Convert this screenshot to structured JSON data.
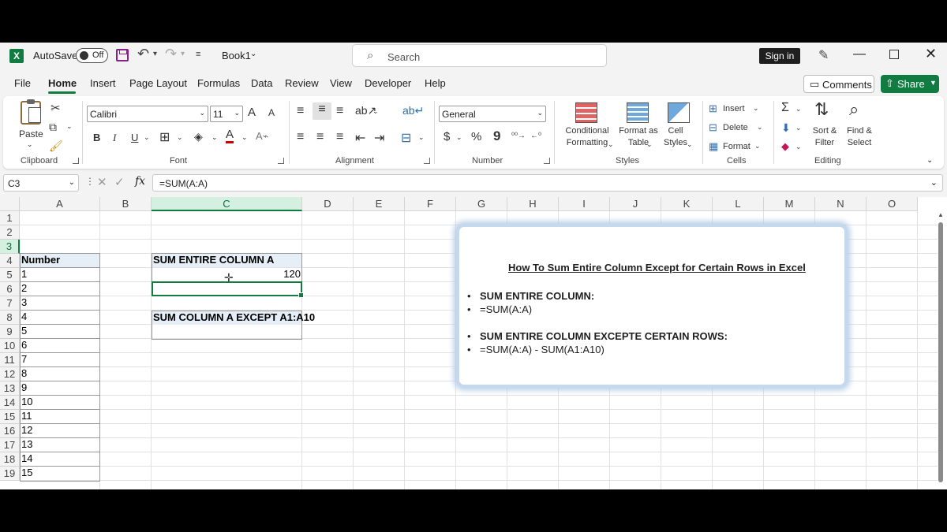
{
  "titlebar": {
    "autosave_label": "AutoSave",
    "autosave_state": "Off",
    "doc_title": "Book1",
    "search_placeholder": "Search",
    "signin_label": "Sign in"
  },
  "tabs": [
    "File",
    "Home",
    "Insert",
    "Page Layout",
    "Formulas",
    "Data",
    "Review",
    "View",
    "Developer",
    "Help"
  ],
  "active_tab": "Home",
  "tab_actions": {
    "comments": "Comments",
    "share": "Share"
  },
  "ribbon": {
    "clipboard": {
      "paste": "Paste",
      "label": "Clipboard"
    },
    "font": {
      "family": "Calibri",
      "size": "11",
      "label": "Font",
      "bold": "B",
      "italic": "I",
      "underline": "U",
      "grow": "A",
      "shrink": "A"
    },
    "alignment": {
      "label": "Alignment"
    },
    "number": {
      "format": "General",
      "currency": "$",
      "percent": "%",
      "comma": "9",
      "label": "Number"
    },
    "styles": {
      "conditional": [
        "Conditional",
        "Formatting"
      ],
      "format_table": [
        "Format as",
        "Table"
      ],
      "cell_styles": [
        "Cell",
        "Styles"
      ],
      "label": "Styles"
    },
    "cells": {
      "insert": "Insert",
      "delete": "Delete",
      "format": "Format",
      "label": "Cells"
    },
    "editing": {
      "sort": [
        "Sort &",
        "Filter"
      ],
      "find": [
        "Find &",
        "Select"
      ],
      "label": "Editing"
    }
  },
  "formula_bar": {
    "name_box": "C3",
    "formula": "=SUM(A:A)"
  },
  "sheet": {
    "columns": [
      "A",
      "B",
      "C",
      "D",
      "E",
      "F",
      "G",
      "H",
      "I",
      "J",
      "K",
      "L",
      "M",
      "N",
      "O"
    ],
    "selected_column": "C",
    "rows": [
      "1",
      "2",
      "3",
      "4",
      "5",
      "6",
      "7",
      "8",
      "9",
      "10",
      "11",
      "12",
      "13",
      "14",
      "15",
      "16",
      "17",
      "18",
      "19"
    ],
    "selected_row": "3",
    "a_header": "Number",
    "a_values": [
      "1",
      "2",
      "3",
      "4",
      "5",
      "6",
      "7",
      "8",
      "9",
      "10",
      "11",
      "12",
      "13",
      "14",
      "15"
    ],
    "c1": "SUM ENTIRE COLUMN A",
    "c2": "120",
    "c5": "SUM COLUMN A EXCEPT A1:A10"
  },
  "info_box": {
    "title": "How To Sum Entire Column Except for Certain Rows in Excel",
    "bullets": [
      {
        "text": "SUM ENTIRE COLUMN:",
        "bold": true
      },
      {
        "text": "=SUM(A:A)",
        "bold": false
      },
      {
        "text": "SUM ENTIRE COLUMN EXCEPTE CERTAIN ROWS:",
        "bold": true
      },
      {
        "text": "=SUM(A:A) - SUM(A1:A10)",
        "bold": false
      }
    ]
  },
  "colors": {
    "excel_green": "#107c41",
    "save_icon": "#8a1f8a",
    "box_glow": "#c4d9ee"
  }
}
